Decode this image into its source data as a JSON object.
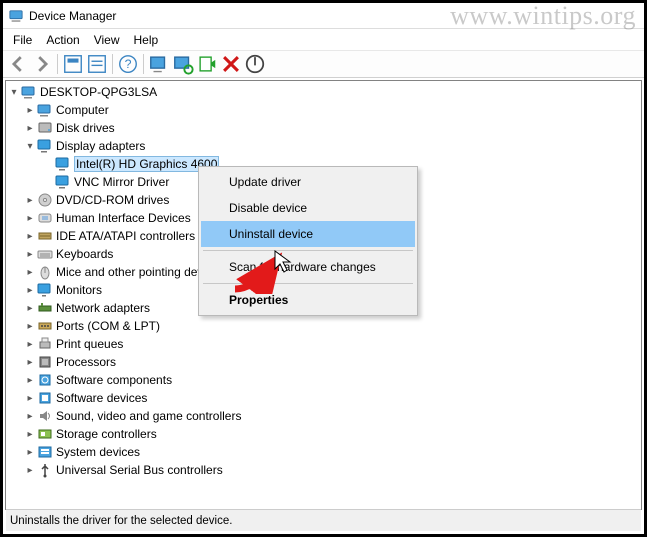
{
  "watermark": "www.wintips.org",
  "window": {
    "title": "Device Manager"
  },
  "menubar": [
    "File",
    "Action",
    "View",
    "Help"
  ],
  "statusbar": "Uninstalls the driver for the selected device.",
  "toolbar_icons": [
    "back",
    "forward",
    "show-hidden",
    "properties",
    "help",
    "monitor",
    "scan",
    "add",
    "delete",
    "update"
  ],
  "tree": {
    "root": {
      "label": "DESKTOP-QPG3LSA",
      "icon": "computer",
      "expanded": true
    },
    "items": [
      {
        "label": "Computer",
        "icon": "computer",
        "expanded": false
      },
      {
        "label": "Disk drives",
        "icon": "disk",
        "expanded": false
      },
      {
        "label": "Display adapters",
        "icon": "display",
        "expanded": true,
        "children": [
          {
            "label": "Intel(R) HD Graphics 4600",
            "icon": "display",
            "selected": true
          },
          {
            "label": "VNC Mirror Driver",
            "icon": "display"
          }
        ]
      },
      {
        "label": "DVD/CD-ROM drives",
        "icon": "cd",
        "expanded": false
      },
      {
        "label": "Human Interface Devices",
        "icon": "hid",
        "expanded": false
      },
      {
        "label": "IDE ATA/ATAPI controllers",
        "icon": "ide",
        "expanded": false
      },
      {
        "label": "Keyboards",
        "icon": "keyboard",
        "expanded": false
      },
      {
        "label": "Mice and other pointing devices",
        "icon": "mouse",
        "expanded": false
      },
      {
        "label": "Monitors",
        "icon": "monitor",
        "expanded": false
      },
      {
        "label": "Network adapters",
        "icon": "network",
        "expanded": false
      },
      {
        "label": "Ports (COM & LPT)",
        "icon": "port",
        "expanded": false
      },
      {
        "label": "Print queues",
        "icon": "printer",
        "expanded": false
      },
      {
        "label": "Processors",
        "icon": "cpu",
        "expanded": false
      },
      {
        "label": "Software components",
        "icon": "swcomp",
        "expanded": false
      },
      {
        "label": "Software devices",
        "icon": "swdev",
        "expanded": false
      },
      {
        "label": "Sound, video and game controllers",
        "icon": "sound",
        "expanded": false
      },
      {
        "label": "Storage controllers",
        "icon": "storage",
        "expanded": false
      },
      {
        "label": "System devices",
        "icon": "system",
        "expanded": false
      },
      {
        "label": "Universal Serial Bus controllers",
        "icon": "usb",
        "expanded": false
      }
    ]
  },
  "contextmenu": {
    "items": [
      {
        "label": "Update driver"
      },
      {
        "label": "Disable device"
      },
      {
        "label": "Uninstall device",
        "highlight": true
      },
      {
        "sep": true
      },
      {
        "label": "Scan for hardware changes"
      },
      {
        "sep": true
      },
      {
        "label": "Properties",
        "bold": true
      }
    ]
  }
}
